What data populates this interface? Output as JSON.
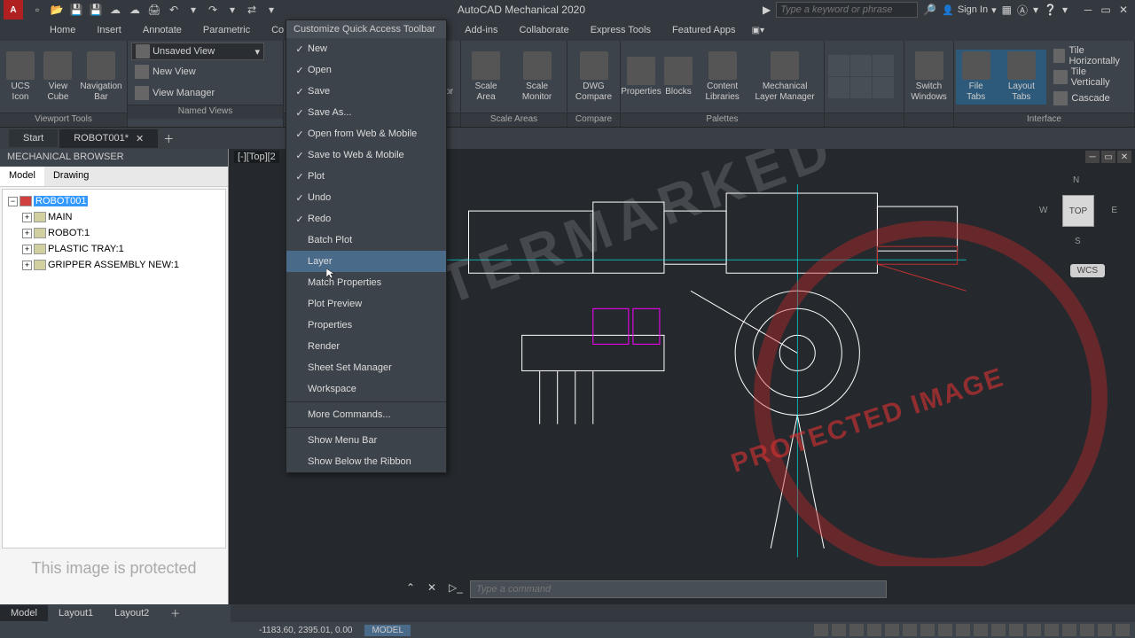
{
  "title": "AutoCAD Mechanical 2020",
  "search_placeholder": "Type a keyword or phrase",
  "signin": "Sign In",
  "menu": [
    "Home",
    "Insert",
    "Annotate",
    "Parametric",
    "Co",
    "",
    "",
    "Add-ins",
    "Collaborate",
    "Express Tools",
    "Featured Apps"
  ],
  "ribbon": {
    "named_views": {
      "label": "Named Views",
      "dropdown": "Unsaved View",
      "new_view": "New View",
      "view_manager": "View Manager"
    },
    "viewport_tools": {
      "label": "Viewport Tools",
      "btn1": "UCS Icon",
      "btn2": "View Cube",
      "btn3": "Navigation Bar"
    },
    "monitor": "All Monitor",
    "scale_areas": {
      "label": "Scale Areas",
      "btn1": "Scale Area",
      "btn2": "Scale Monitor"
    },
    "compare": {
      "label": "Compare",
      "btn": "DWG Compare"
    },
    "palettes": {
      "label": "Palettes",
      "btn1": "Properties",
      "btn2": "Blocks",
      "btn3": "Content Libraries",
      "btn4": "Mechanical Layer Manager"
    },
    "switch": "Switch Windows",
    "interface": {
      "label": "Interface",
      "file_tabs": "File Tabs",
      "layout_tabs": "Layout Tabs",
      "h": "Tile Horizontally",
      "v": "Tile Vertically",
      "c": "Cascade"
    }
  },
  "doctabs": {
    "start": "Start",
    "file": "ROBOT001*"
  },
  "browser": {
    "title": "MECHANICAL BROWSER",
    "tabs": {
      "model": "Model",
      "drawing": "Drawing"
    },
    "tree": {
      "root": "ROBOT001",
      "children": [
        "MAIN",
        "ROBOT:1",
        "PLASTIC TRAY:1",
        "GRIPPER ASSEMBLY NEW:1"
      ]
    }
  },
  "protected_note": "This image is protected",
  "viewport_label": "[-][Top][2",
  "viewcube": {
    "top": "TOP",
    "n": "N",
    "s": "S",
    "e": "E",
    "w": "W"
  },
  "wcs": "WCS",
  "cmd_placeholder": "Type a command",
  "qat_menu": {
    "title": "Customize Quick Access Toolbar",
    "items": [
      {
        "label": "New",
        "checked": true
      },
      {
        "label": "Open",
        "checked": true
      },
      {
        "label": "Save",
        "checked": true
      },
      {
        "label": "Save As...",
        "checked": true
      },
      {
        "label": "Open from Web & Mobile",
        "checked": true
      },
      {
        "label": "Save to Web & Mobile",
        "checked": true
      },
      {
        "label": "Plot",
        "checked": true
      },
      {
        "label": "Undo",
        "checked": true
      },
      {
        "label": "Redo",
        "checked": true
      },
      {
        "label": "Batch Plot",
        "checked": false
      },
      {
        "label": "Layer",
        "checked": false,
        "highlight": true
      },
      {
        "label": "Match Properties",
        "checked": false
      },
      {
        "label": "Plot Preview",
        "checked": false
      },
      {
        "label": "Properties",
        "checked": false
      },
      {
        "label": "Render",
        "checked": false
      },
      {
        "label": "Sheet Set Manager",
        "checked": false
      },
      {
        "label": "Workspace",
        "checked": false
      }
    ],
    "more": "More Commands...",
    "menubar": "Show Menu Bar",
    "below": "Show Below the Ribbon"
  },
  "layout": {
    "model": "Model",
    "l1": "Layout1",
    "l2": "Layout2"
  },
  "status": {
    "coords": "-1183.60, 2395.01, 0.00",
    "mode": "MODEL"
  },
  "watermark": "WATERMARKED",
  "stamp": "PROTECTED IMAGE"
}
